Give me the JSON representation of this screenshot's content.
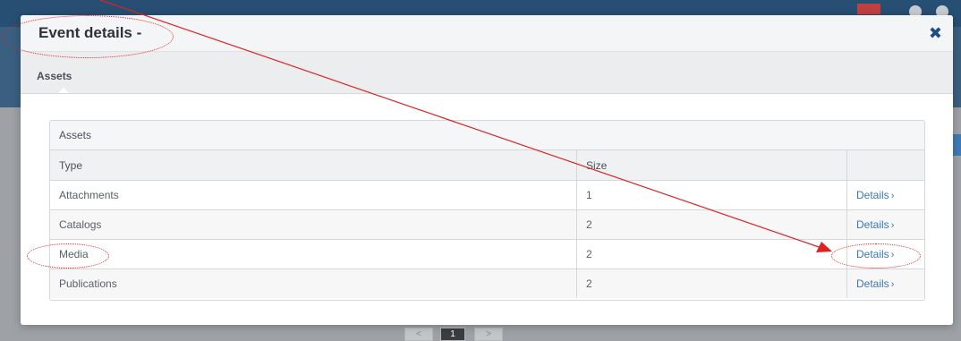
{
  "modal": {
    "title": "Event details -",
    "close_glyph": "✖",
    "tab_label": "Assets"
  },
  "panel": {
    "heading": "Assets",
    "columns": [
      "Type",
      "Size",
      ""
    ],
    "rows": [
      {
        "type": "Attachments",
        "size": "1",
        "action": "Details"
      },
      {
        "type": "Catalogs",
        "size": "2",
        "action": "Details"
      },
      {
        "type": "Media",
        "size": "2",
        "action": "Details"
      },
      {
        "type": "Publications",
        "size": "2",
        "action": "Details"
      }
    ]
  },
  "pager": {
    "prev": "<",
    "current": "1",
    "next": ">"
  },
  "colors": {
    "accent": "#3b79b5",
    "header_bg": "#f4f5f6",
    "annotation": "#dd2222"
  },
  "icons": [
    "close-icon",
    "chevron-right-icon"
  ]
}
